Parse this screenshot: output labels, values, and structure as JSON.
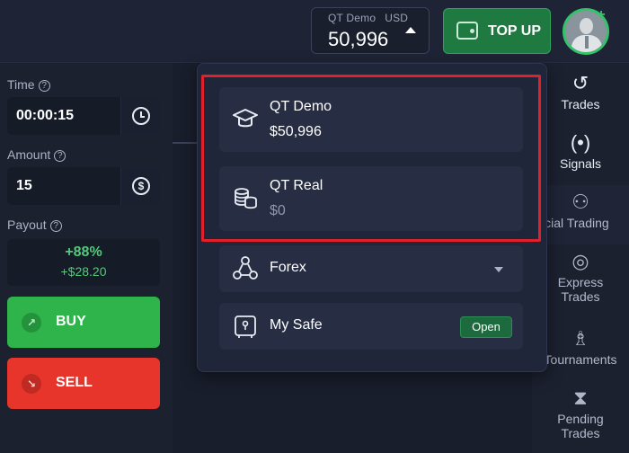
{
  "header": {
    "balance_label": "QT Demo",
    "balance_currency": "USD",
    "balance_value": "50,996",
    "topup_label": "TOP UP"
  },
  "left_panel": {
    "time_label": "Time",
    "time_value": "00:00:15",
    "amount_label": "Amount",
    "amount_value": "15",
    "payout_label": "Payout",
    "payout_percent": "+88%",
    "payout_amount": "+$28.20",
    "buy_label": "BUY",
    "sell_label": "SELL"
  },
  "dropdown": {
    "accounts": [
      {
        "title": "QT Demo",
        "balance": "$50,996"
      },
      {
        "title": "QT Real",
        "balance": "$0"
      }
    ],
    "forex_label": "Forex",
    "safe_label": "My Safe",
    "safe_action": "Open"
  },
  "right_sidebar": {
    "items": [
      {
        "label": "Trades",
        "icon": "history-icon"
      },
      {
        "label": "Signals",
        "icon": "signal-tower-icon"
      },
      {
        "label": "ocial Trading",
        "icon": "people-icon"
      },
      {
        "label_line1": "Express",
        "label_line2": "Trades",
        "icon": "target-icon"
      },
      {
        "label": "Tournaments",
        "icon": "trophy-icon"
      },
      {
        "label_line1": "Pending",
        "label_line2": "Trades",
        "icon": "hourglass-icon"
      }
    ]
  },
  "colors": {
    "buy": "#2fb34b",
    "sell": "#e8352c",
    "topup": "#1f7a42",
    "highlight": "#e0202a",
    "payout": "#55c97a"
  }
}
